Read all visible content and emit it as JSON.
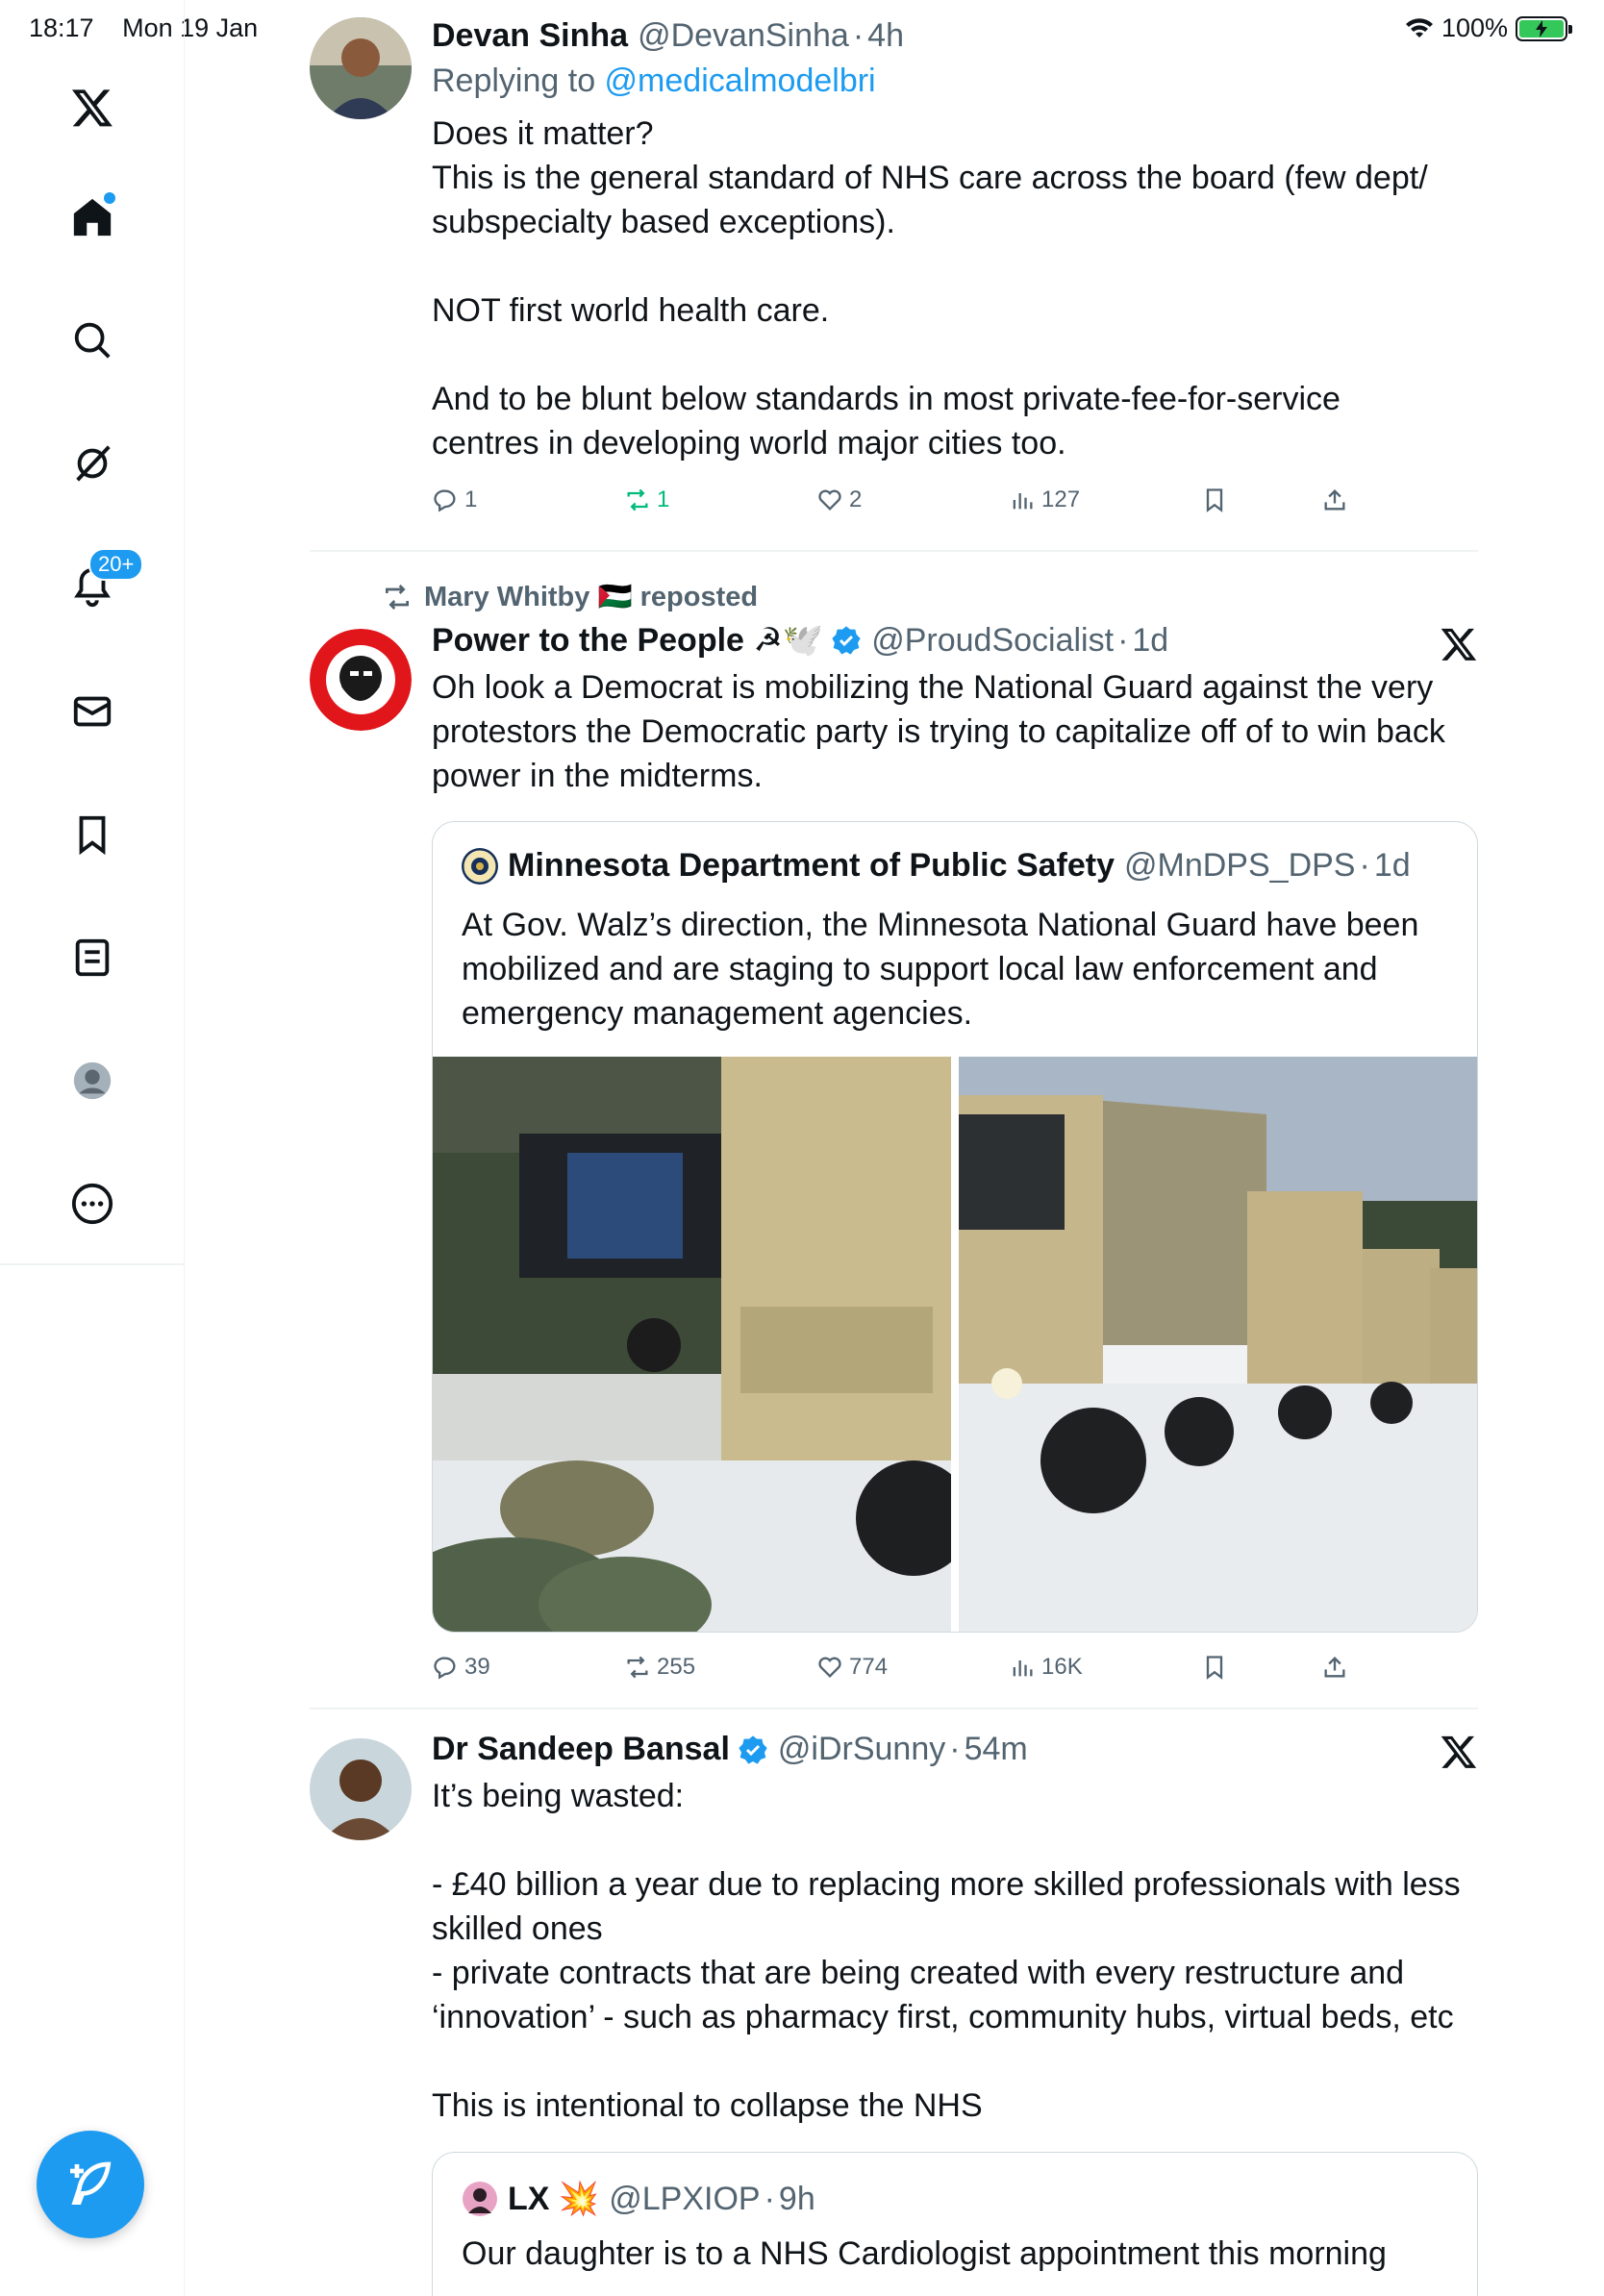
{
  "status_bar": {
    "time": "18:17",
    "date": "Mon 19 Jan",
    "battery": "100%"
  },
  "sidebar": {
    "notifications_badge": "20+",
    "items": [
      "home",
      "search",
      "grok",
      "notifications",
      "messages",
      "bookmarks",
      "lists",
      "profile",
      "more"
    ]
  },
  "tweets": [
    {
      "name": "Devan Sinha",
      "handle": "@DevanSinha",
      "time": "4h",
      "replying_to_prefix": "Replying to ",
      "replying_to": "@medicalmodelbri",
      "text": "Does it matter?\nThis is the general standard of NHS care across the board (few dept/\nsubspecialty based exceptions).\n\nNOT first world health care.\n\nAnd to be blunt below standards in most private-fee-for-service\ncentres in developing world major cities too.",
      "replies": "1",
      "reposts": "1",
      "likes": "2",
      "views": "127"
    },
    {
      "repost_label": "Mary Whitby 🇵🇸 reposted",
      "name": "Power to the People ☭🕊️",
      "handle": "@ProudSocialist",
      "time": "1d",
      "text": "Oh look a Democrat is mobilizing the National Guard against the very\nprotestors the Democratic party is trying to capitalize off of to win back\npower in the midterms.",
      "quote": {
        "name": "Minnesota Department of Public Safety",
        "handle": "@MnDPS_DPS",
        "time": "1d",
        "text": "At Gov. Walz’s direction, the Minnesota National Guard have been\nmobilized and are staging to support local law enforcement and\nemergency management agencies."
      },
      "replies": "39",
      "reposts": "255",
      "likes": "774",
      "views": "16K"
    },
    {
      "name": "Dr Sandeep Bansal",
      "handle": "@iDrSunny",
      "time": "54m",
      "text": "It’s being wasted:\n\n- £40 billion a year due to replacing more skilled professionals with less\nskilled ones\n- private contracts that are being created with every restructure and\n‘innovation’ - such as pharmacy first, community hubs, virtual beds, etc\n\nThis is intentional to collapse the NHS",
      "quote": {
        "name": "LX 💥",
        "handle": "@LPXIOP",
        "time": "9h",
        "text": "Our daughter is to a NHS Cardiologist appointment this morning"
      }
    }
  ],
  "colors": {
    "accent": "#1d9bf0",
    "repost_green": "#00ba7c",
    "secondary_text": "#536471"
  }
}
